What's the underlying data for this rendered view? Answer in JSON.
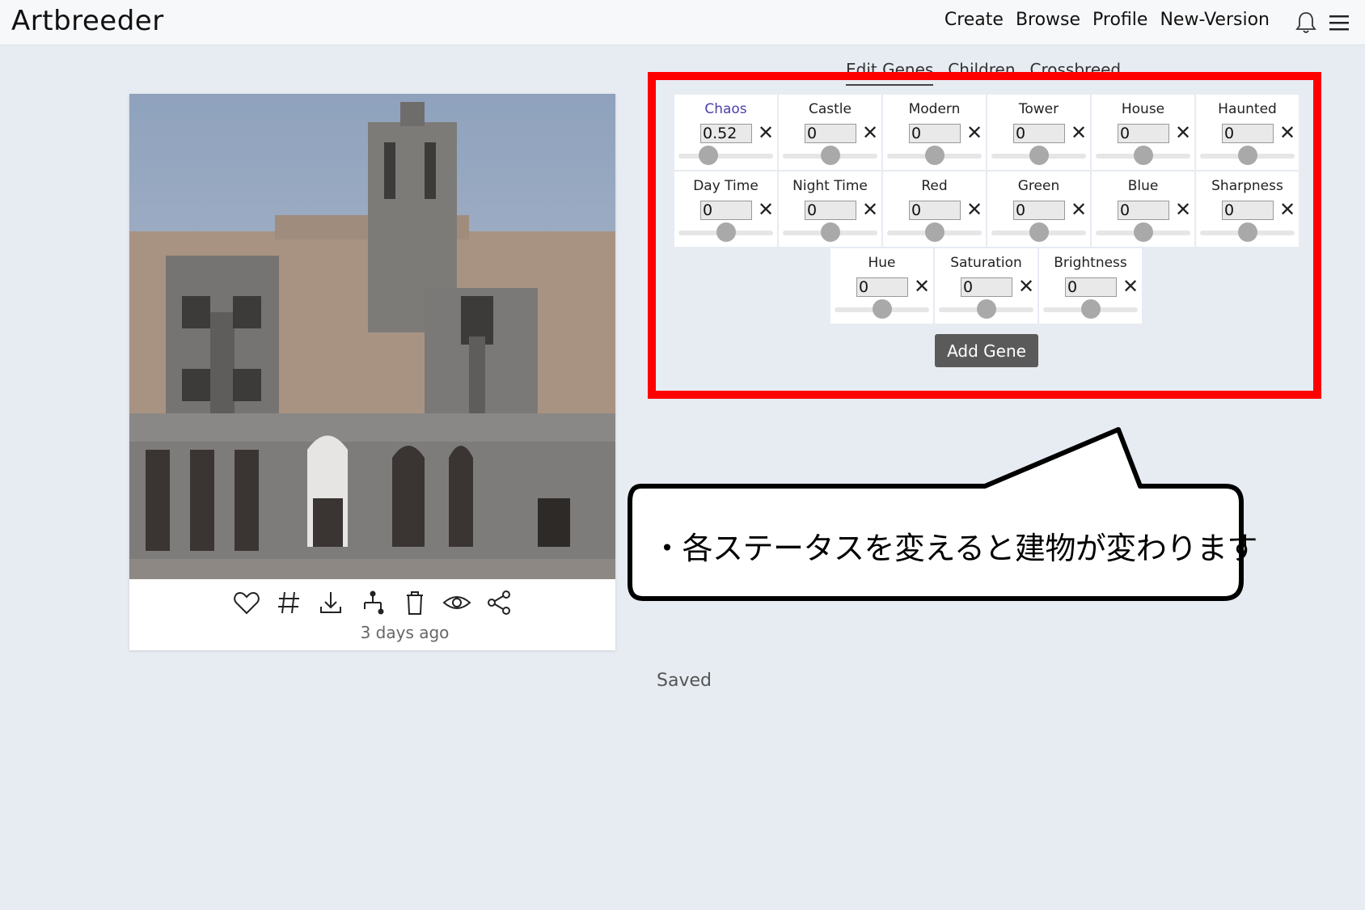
{
  "app": {
    "brand": "Artbreeder",
    "nav": [
      "Create",
      "Browse",
      "Profile",
      "New-Version"
    ]
  },
  "card": {
    "timestamp": "3 days ago",
    "actions": [
      "heart-icon",
      "hashtag-icon",
      "download-icon",
      "lineage-icon",
      "trash-icon",
      "eye-icon",
      "share-icon"
    ]
  },
  "tabs": [
    "Edit Genes",
    "Children",
    "Crossbreed"
  ],
  "genes": [
    {
      "label": "Chaos",
      "value": "0.52",
      "level": 0.32
    },
    {
      "label": "Castle",
      "value": "0",
      "level": 0.5
    },
    {
      "label": "Modern",
      "value": "0",
      "level": 0.5
    },
    {
      "label": "Tower",
      "value": "0",
      "level": 0.5
    },
    {
      "label": "House",
      "value": "0",
      "level": 0.5
    },
    {
      "label": "Haunted",
      "value": "0",
      "level": 0.5
    },
    {
      "label": "Day Time",
      "value": "0",
      "level": 0.5
    },
    {
      "label": "Night Time",
      "value": "0",
      "level": 0.5
    },
    {
      "label": "Red",
      "value": "0",
      "level": 0.5
    },
    {
      "label": "Green",
      "value": "0",
      "level": 0.5
    },
    {
      "label": "Blue",
      "value": "0",
      "level": 0.5
    },
    {
      "label": "Sharpness",
      "value": "0",
      "level": 0.5
    },
    {
      "label": "Hue",
      "value": "0",
      "level": 0.5
    },
    {
      "label": "Saturation",
      "value": "0",
      "level": 0.5
    },
    {
      "label": "Brightness",
      "value": "0",
      "level": 0.5
    }
  ],
  "add_gene_label": "Add Gene",
  "status": "Saved",
  "annotation": "・各ステータスを変えると建物が変わります",
  "colors": {
    "highlight": "#ff0000",
    "accent": "#4a3fa8",
    "button": "#5a5a5a"
  }
}
